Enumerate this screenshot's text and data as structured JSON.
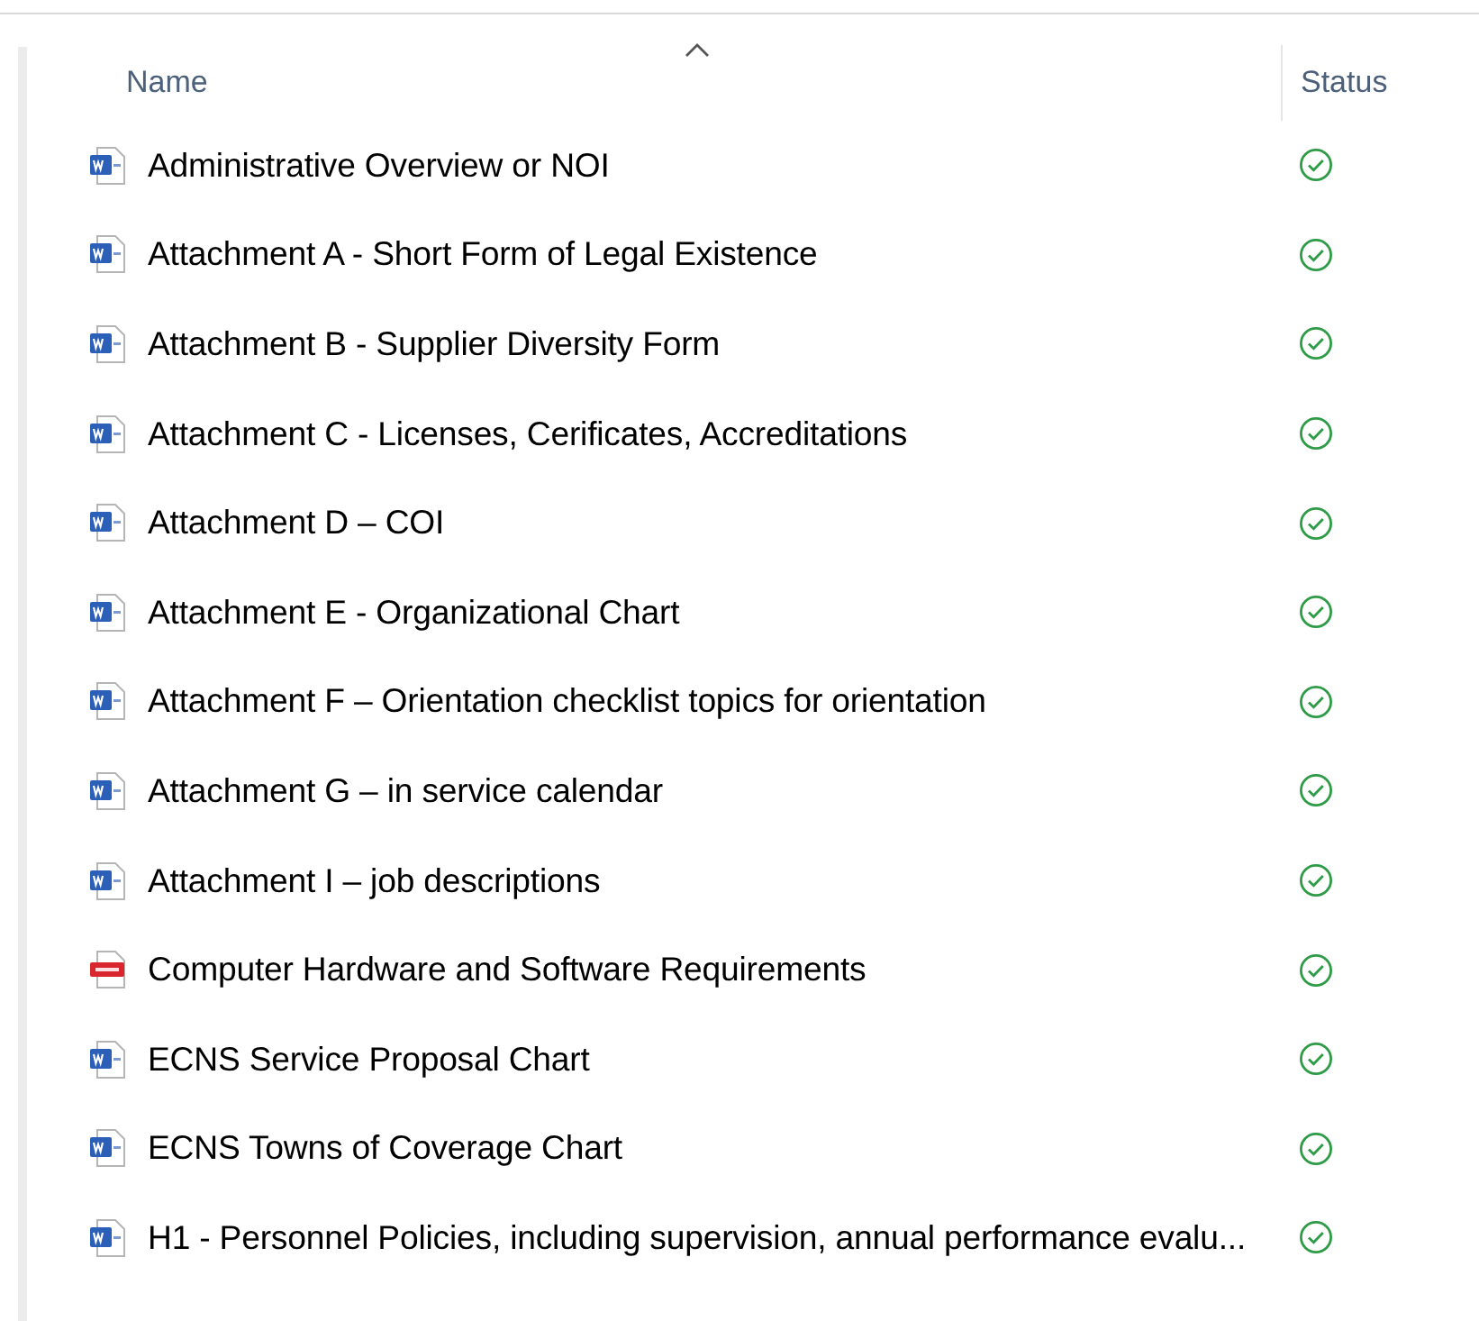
{
  "columns": [
    {
      "label": "Name",
      "sorted": true
    },
    {
      "label": "Status",
      "sorted": false
    }
  ],
  "files": [
    {
      "name": "Administrative Overview or NOI",
      "kind": "word",
      "available": true
    },
    {
      "name": "Attachment A - Short Form of Legal Existence",
      "kind": "word",
      "available": true
    },
    {
      "name": "Attachment B - Supplier Diversity Form",
      "kind": "word",
      "available": true
    },
    {
      "name": "Attachment C - Licenses, Cerificates, Accreditations",
      "kind": "word",
      "available": true
    },
    {
      "name": "Attachment D – COI",
      "kind": "word",
      "available": true
    },
    {
      "name": "Attachment E - Organizational Chart",
      "kind": "word",
      "available": true
    },
    {
      "name": "Attachment F – Orientation checklist topics for orientation",
      "kind": "word",
      "available": true
    },
    {
      "name": "Attachment G – in service calendar",
      "kind": "word",
      "available": true
    },
    {
      "name": "Attachment I – job descriptions",
      "kind": "word",
      "available": true
    },
    {
      "name": "Computer Hardware and Software Requirements",
      "kind": "pdf",
      "available": true
    },
    {
      "name": "ECNS Service Proposal Chart",
      "kind": "word",
      "available": true
    },
    {
      "name": "ECNS Towns of Coverage Chart",
      "kind": "word",
      "available": true
    },
    {
      "name": "H1 - Personnel Policies, including supervision, annual performance evalu...",
      "kind": "word",
      "available": true
    }
  ]
}
